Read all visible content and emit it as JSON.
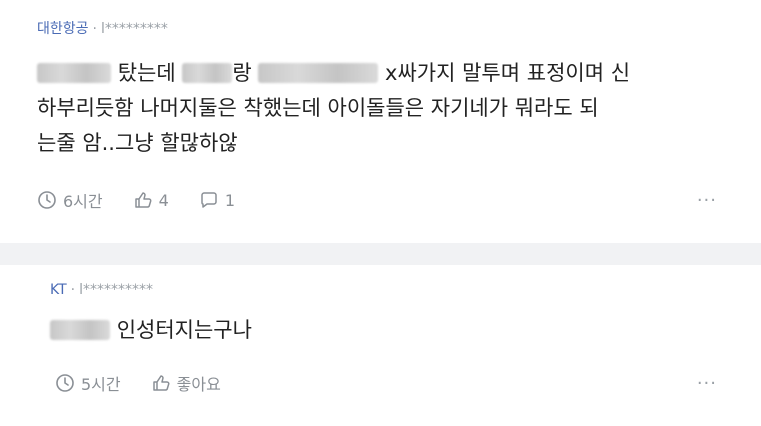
{
  "comments": [
    {
      "author": "대한항공",
      "separator": "·",
      "user_id": "l*********",
      "text_seg1": "탔는데",
      "text_seg2": "랑",
      "text_seg3": "x싸가지 말투며 표정이며 신",
      "line2": "하부리듯함 나머지둘은 착했는데 아이돌들은 자기네가 뭐라도 되",
      "line3": "는줄 암..그냥 할많하않",
      "time": "6시간",
      "likes": "4",
      "replies": "1",
      "more": "···"
    },
    {
      "author": "KT",
      "separator": "·",
      "user_id": "l**********",
      "text": "인성터지는구나",
      "time": "5시간",
      "like_label": "좋아요",
      "more": "···"
    }
  ],
  "colors": {
    "author": "#4a6bb5",
    "meta": "#9aa0a6",
    "separator_band": "#f1f2f4"
  }
}
